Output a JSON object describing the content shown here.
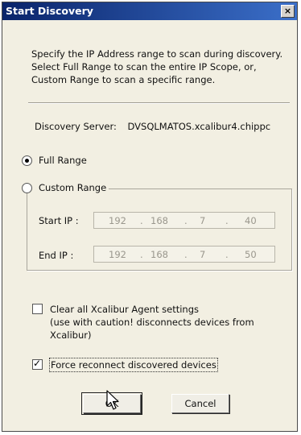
{
  "window": {
    "title": "Start Discovery",
    "close_glyph": "×"
  },
  "intro_text": "Specify the IP Address range to scan during discovery. Select Full Range to scan the entire IP Scope, or, Custom Range to scan a specific range.",
  "server": {
    "label": "Discovery Server:",
    "value": "DVSQLMATOS.xcalibur4.chippc"
  },
  "range": {
    "full_label": "Full Range",
    "custom_label": "Custom Range",
    "selected": "full"
  },
  "start_ip": {
    "label": "Start IP :",
    "octets": [
      "192",
      "168",
      "7",
      "40"
    ]
  },
  "end_ip": {
    "label": "End IP :",
    "octets": [
      "192",
      "168",
      "7",
      "50"
    ]
  },
  "ip_separator": ".",
  "options": {
    "clear_settings": {
      "lines": [
        "Clear all Xcalibur Agent settings",
        "(use with caution! disconnects devices from",
        "Xcalibur)"
      ],
      "checked": false
    },
    "force_reconnect": {
      "label": "Force reconnect discovered devices",
      "checked": true
    }
  },
  "buttons": {
    "ok": "OK",
    "cancel": "Cancel"
  }
}
